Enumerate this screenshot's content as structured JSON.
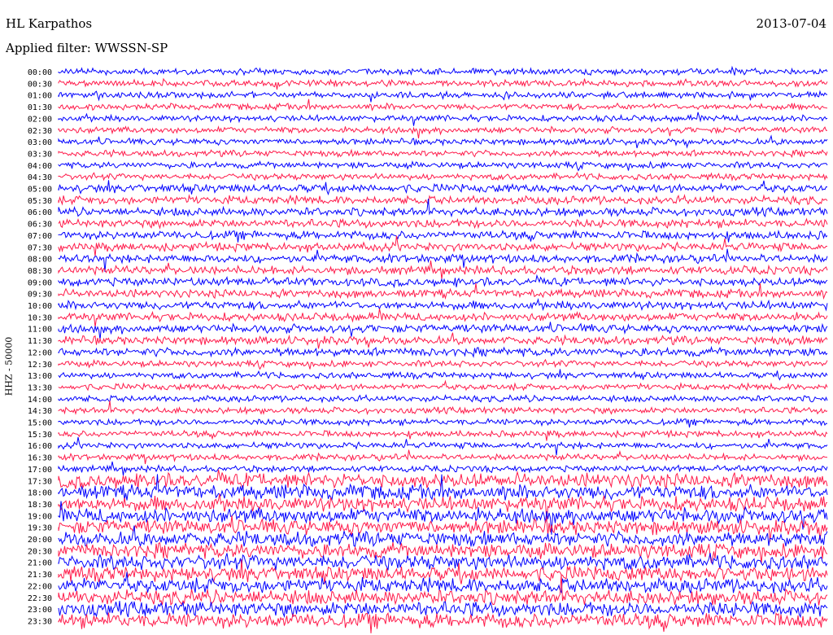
{
  "header": {
    "station": "HL Karpathos",
    "filter": "Applied filter: WWSSN-SP",
    "date": "2013-07-04"
  },
  "colors": {
    "trace_a": "#0000ff",
    "trace_b": "#ff1a4a",
    "background": "#ffffff"
  },
  "chart_data": {
    "type": "line",
    "ylabel": "HHZ - 50000",
    "categories": [
      "00:00",
      "00:30",
      "01:00",
      "01:30",
      "02:00",
      "02:30",
      "03:00",
      "03:30",
      "04:00",
      "04:30",
      "05:00",
      "05:30",
      "06:00",
      "06:30",
      "07:00",
      "07:30",
      "08:00",
      "08:30",
      "09:00",
      "09:30",
      "10:00",
      "10:30",
      "11:00",
      "11:30",
      "12:00",
      "12:30",
      "13:00",
      "13:30",
      "14:00",
      "14:30",
      "15:00",
      "15:30",
      "16:00",
      "16:30",
      "17:00",
      "17:30",
      "18:00",
      "18:30",
      "19:00",
      "19:30",
      "20:00",
      "20:30",
      "21:00",
      "21:30",
      "22:00",
      "22:30",
      "23:00",
      "23:30"
    ],
    "row_colors": "alternate blue/red starting with blue",
    "grid": false,
    "legend": "none"
  }
}
